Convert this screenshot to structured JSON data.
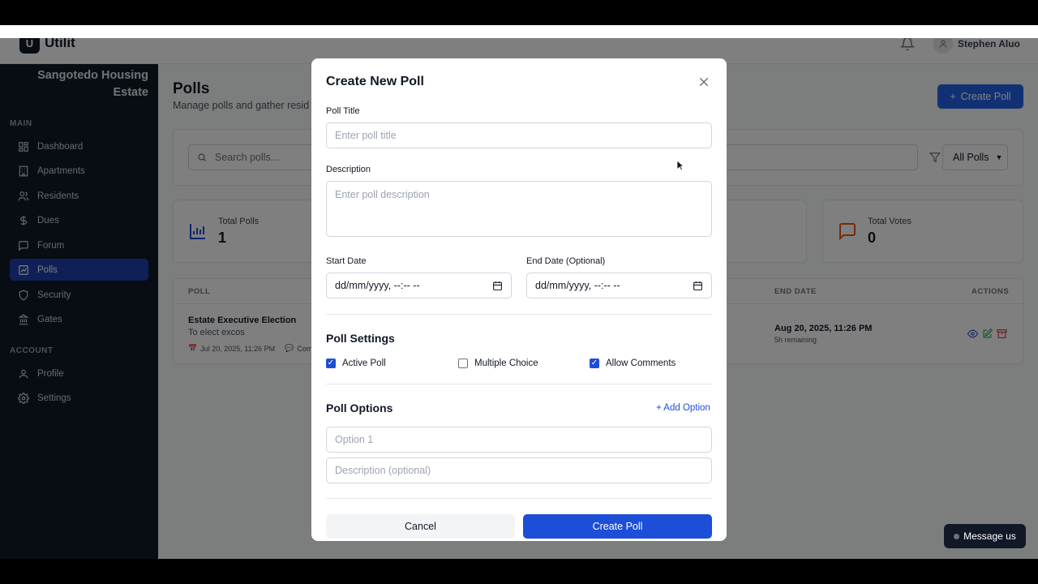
{
  "app": {
    "logo_letter": "U",
    "name": "Utilit"
  },
  "header": {
    "user_name": "Stephen Aluo"
  },
  "sidebar": {
    "estate_name": "Sangotedo Housing Estate",
    "main_label": "MAIN",
    "account_label": "ACCOUNT",
    "items": [
      {
        "label": "Dashboard",
        "icon": "grid-icon"
      },
      {
        "label": "Apartments",
        "icon": "building-icon"
      },
      {
        "label": "Residents",
        "icon": "users-icon"
      },
      {
        "label": "Dues",
        "icon": "dollar-icon"
      },
      {
        "label": "Forum",
        "icon": "chat-icon"
      },
      {
        "label": "Polls",
        "icon": "chart-icon",
        "active": true
      },
      {
        "label": "Security",
        "icon": "shield-icon"
      },
      {
        "label": "Gates",
        "icon": "gate-icon"
      }
    ],
    "account_items": [
      {
        "label": "Profile",
        "icon": "user-icon"
      },
      {
        "label": "Settings",
        "icon": "gear-icon"
      }
    ]
  },
  "page": {
    "title": "Polls",
    "subtitle": "Manage polls and gather resid",
    "create_label": "Create Poll",
    "search_placeholder": "Search polls...",
    "filter_value": "All Polls"
  },
  "stats": [
    {
      "label": "Total Polls",
      "value": "1"
    },
    {
      "label": "Total Votes",
      "value": "0"
    }
  ],
  "table": {
    "headers": {
      "poll": "POLL",
      "end_date": "END DATE",
      "actions": "ACTIONS"
    },
    "row": {
      "title": "Estate Executive Election",
      "subtitle": "To elect excos",
      "start": "Jul 20, 2025, 11:26 PM",
      "comments": "Com",
      "end_date": "Aug 20, 2025, 11:26 PM",
      "remaining": "5h remaining"
    }
  },
  "modal": {
    "title": "Create New Poll",
    "poll_title_label": "Poll Title",
    "poll_title_placeholder": "Enter poll title",
    "description_label": "Description",
    "description_placeholder": "Enter poll description",
    "start_date_label": "Start Date",
    "end_date_label": "End Date (Optional)",
    "date_placeholder": "dd/mm/yyyy, --:-- --",
    "settings_title": "Poll Settings",
    "settings": [
      {
        "label": "Active Poll",
        "checked": true
      },
      {
        "label": "Multiple Choice",
        "checked": false
      },
      {
        "label": "Allow Comments",
        "checked": true
      }
    ],
    "options_title": "Poll Options",
    "add_option_label": "Add Option",
    "option_placeholder": "Option 1",
    "option_desc_placeholder": "Description (optional)",
    "cancel_label": "Cancel",
    "create_label": "Create Poll"
  },
  "chat": {
    "label": "Message us"
  },
  "colors": {
    "primary": "#1d4ed8",
    "sidebar": "#111827",
    "orange": "#ea580c",
    "green": "#16a34a",
    "red": "#dc2626"
  }
}
